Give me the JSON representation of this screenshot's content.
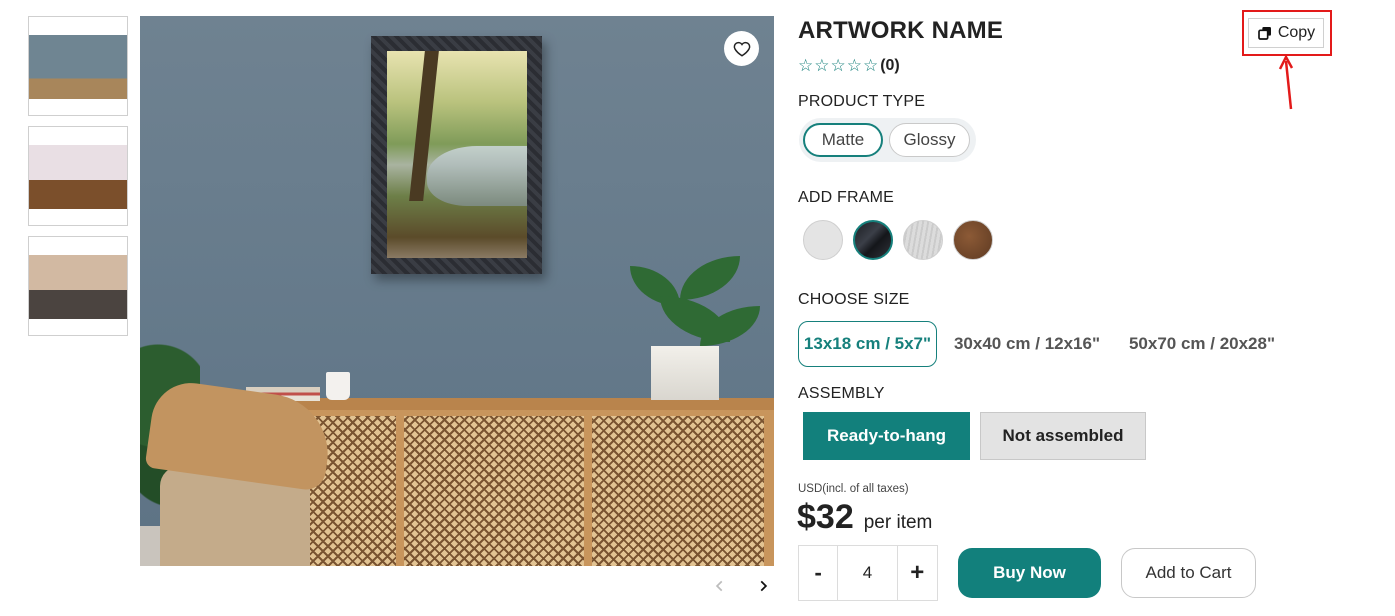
{
  "product": {
    "title": "ARTWORK NAME",
    "stars": "☆☆☆☆☆",
    "rating_count": "(0)"
  },
  "copy_button": {
    "label": "Copy"
  },
  "sections": {
    "product_type": "PRODUCT TYPE",
    "add_frame": "ADD FRAME",
    "choose_size": "CHOOSE SIZE",
    "assembly": "ASSEMBLY"
  },
  "product_types": [
    {
      "label": "Matte",
      "selected": true
    },
    {
      "label": "Glossy",
      "selected": false
    }
  ],
  "frames": [
    {
      "name": "white-frame",
      "selected": false
    },
    {
      "name": "black-frame",
      "selected": true
    },
    {
      "name": "silver-frame",
      "selected": false
    },
    {
      "name": "wood-frame",
      "selected": false
    }
  ],
  "sizes": [
    {
      "label": "13x18 cm / 5x7\"",
      "selected": true
    },
    {
      "label": "30x40 cm / 12x16\"",
      "selected": false
    },
    {
      "label": "50x70 cm / 20x28\"",
      "selected": false
    }
  ],
  "assembly": [
    {
      "label": "Ready-to-hang",
      "selected": true
    },
    {
      "label": "Not assembled",
      "selected": false
    }
  ],
  "pricing": {
    "note": "USD(incl. of all taxes)",
    "amount": "$32",
    "unit": "per item"
  },
  "quantity": {
    "minus": "-",
    "value": "4",
    "plus": "+"
  },
  "actions": {
    "buy_now": "Buy Now",
    "add_to_cart": "Add to Cart"
  },
  "icons": {
    "favorite": "heart-icon",
    "copy": "copy-icon",
    "prev": "chevron-left-icon",
    "next": "chevron-right-icon"
  },
  "colors": {
    "accent": "#12807c",
    "highlight_box": "#e31a1a"
  }
}
